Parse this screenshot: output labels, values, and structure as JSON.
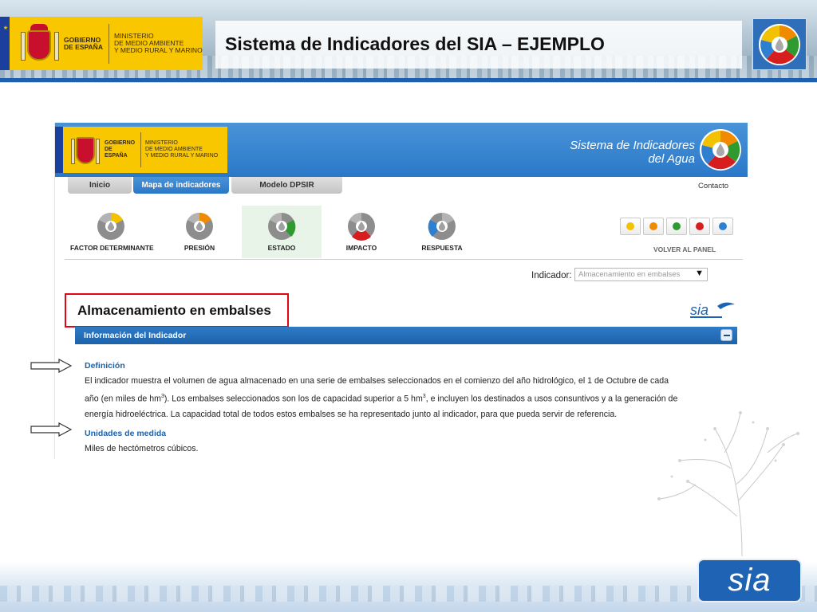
{
  "slide": {
    "title": "Sistema de Indicadores del SIA – EJEMPLO",
    "gov_logo": {
      "gobierno": "GOBIERNO\nDE ESPAÑA",
      "ministerio": "MINISTERIO\nDE MEDIO AMBIENTE\nY MEDIO RURAL Y MARINO"
    },
    "bottom_logo_text": "sia"
  },
  "web": {
    "header": {
      "gobierno": "GOBIERNO\nDE ESPAÑA",
      "ministerio": "MINISTERIO\nDE MEDIO AMBIENTE\nY MEDIO RURAL Y MARINO",
      "site_title": "Sistema de Indicadores\ndel Agua"
    },
    "nav": {
      "tabs": [
        {
          "label": "Inicio",
          "active": false
        },
        {
          "label": "Mapa de indicadores",
          "active": true
        },
        {
          "label": "Modelo DPSIR",
          "active": false
        }
      ],
      "contact": "Contacto"
    },
    "dpsir": [
      {
        "label": "FACTOR DETERMINANTE",
        "color": "#f2c200",
        "active": false
      },
      {
        "label": "PRESIÓN",
        "color": "#f08a00",
        "active": false
      },
      {
        "label": "ESTADO",
        "color": "#2f9a2f",
        "active": true
      },
      {
        "label": "IMPACTO",
        "color": "#d71e1e",
        "active": false
      },
      {
        "label": "RESPUESTA",
        "color": "#2e7fd0",
        "active": false
      }
    ],
    "mini_icons": [
      "#f2c200",
      "#f08a00",
      "#2f9a2f",
      "#d71e1e",
      "#2e7fd0"
    ],
    "volver": "VOLVER AL PANEL",
    "indicador": {
      "label": "Indicador:",
      "selected": "Almacenamiento en embalses"
    },
    "indicator_title": "Almacenamiento en embalses",
    "sia_small": "sia",
    "info_bar": "Información del Indicador",
    "definicion": {
      "title": "Definición",
      "line1": "El indicador muestra el volumen de agua almacenado en una serie de embalses seleccionados en el comienzo del año hidrológico, el 1 de Octubre de cada",
      "line2a": "año (en miles de hm",
      "line2b": "). Los embalses seleccionados son los de capacidad superior a 5 hm",
      "line2c": ", e incluyen los destinados a usos consuntivos y a la generación de",
      "sup": "3",
      "line3": "energía hidroeléctrica. La capacidad total de todos estos embalses se ha representado junto al indicador, para que pueda servir de referencia."
    },
    "unidades": {
      "title": "Unidades de medida",
      "text": "Miles de hectómetros cúbicos."
    }
  },
  "colors": {
    "accent_blue": "#2a78c8",
    "highlight_red": "#e30613",
    "gov_yellow": "#f9c700"
  }
}
